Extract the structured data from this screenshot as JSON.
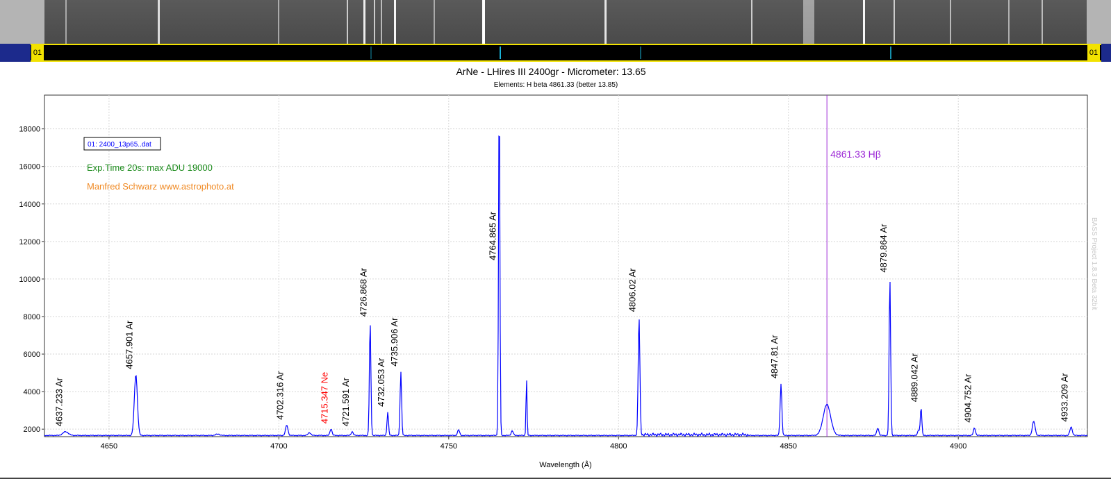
{
  "image_strip": {
    "channel_label_left": "01",
    "channel_label_right": "01"
  },
  "chart_data": {
    "type": "line",
    "title": "ArNe - LHires III 2400gr - Micrometer: 13.65",
    "subtitle": "Elements: H beta 4861.33 (better 13.85)",
    "xlabel": "Wavelength (Å)",
    "ylabel": "",
    "xlim": [
      4631,
      4938
    ],
    "ylim": [
      1600,
      19800
    ],
    "xticks": [
      4650,
      4700,
      4750,
      4800,
      4850,
      4900
    ],
    "yticks": [
      2000,
      4000,
      6000,
      8000,
      10000,
      12000,
      14000,
      16000,
      18000
    ],
    "grid": true,
    "legend": "top-left",
    "baseline": 1650,
    "series": [
      {
        "name": "01: 2400_13p65..dat",
        "color": "#0000ff",
        "peaks": [
          {
            "x": 4637.233,
            "y": 1850,
            "w": 0.8
          },
          {
            "x": 4657.901,
            "y": 4900,
            "w": 0.45
          },
          {
            "x": 4682.0,
            "y": 1720,
            "w": 0.6
          },
          {
            "x": 4702.316,
            "y": 2200,
            "w": 0.35
          },
          {
            "x": 4709.0,
            "y": 1800,
            "w": 0.4
          },
          {
            "x": 4715.347,
            "y": 2000,
            "w": 0.3
          },
          {
            "x": 4721.591,
            "y": 1850,
            "w": 0.3
          },
          {
            "x": 4726.868,
            "y": 7700,
            "w": 0.22
          },
          {
            "x": 4732.053,
            "y": 2900,
            "w": 0.22
          },
          {
            "x": 4735.906,
            "y": 5050,
            "w": 0.22
          },
          {
            "x": 4752.9,
            "y": 1950,
            "w": 0.3
          },
          {
            "x": 4764.865,
            "y": 19800,
            "w": 0.2
          },
          {
            "x": 4768.7,
            "y": 1900,
            "w": 0.3
          },
          {
            "x": 4772.9,
            "y": 4700,
            "w": 0.15
          },
          {
            "x": 4806.02,
            "y": 7950,
            "w": 0.25
          },
          {
            "x": 4847.81,
            "y": 4400,
            "w": 0.25
          },
          {
            "x": 4861.33,
            "y": 3300,
            "w": 1.1
          },
          {
            "x": 4876.3,
            "y": 2050,
            "w": 0.3
          },
          {
            "x": 4879.864,
            "y": 10050,
            "w": 0.22
          },
          {
            "x": 4888.3,
            "y": 1950,
            "w": 0.25
          },
          {
            "x": 4889.042,
            "y": 3150,
            "w": 0.22
          },
          {
            "x": 4904.752,
            "y": 2050,
            "w": 0.3
          },
          {
            "x": 4922.2,
            "y": 2400,
            "w": 0.4
          },
          {
            "x": 4933.209,
            "y": 2100,
            "w": 0.35
          }
        ]
      }
    ],
    "line_labels": [
      {
        "text": "4637.233 Ar",
        "x": 4637.233,
        "color": "#000000"
      },
      {
        "text": "4657.901 Ar",
        "x": 4657.901,
        "color": "#000000"
      },
      {
        "text": "4702.316 Ar",
        "x": 4702.316,
        "color": "#000000"
      },
      {
        "text": "4715.347 Ne",
        "x": 4715.347,
        "color": "#ff0000"
      },
      {
        "text": "4721.591 Ar",
        "x": 4721.591,
        "color": "#000000"
      },
      {
        "text": "4726.868 Ar",
        "x": 4726.868,
        "color": "#000000"
      },
      {
        "text": "4732.053 Ar",
        "x": 4732.053,
        "color": "#000000"
      },
      {
        "text": "4735.906 Ar",
        "x": 4735.906,
        "color": "#000000"
      },
      {
        "text": "4764.865 Ar",
        "x": 4764.865,
        "color": "#000000"
      },
      {
        "text": "4806.02 Ar",
        "x": 4806.02,
        "color": "#000000"
      },
      {
        "text": "4847.81 Ar",
        "x": 4847.81,
        "color": "#000000"
      },
      {
        "text": "4879.864 Ar",
        "x": 4879.864,
        "color": "#000000"
      },
      {
        "text": "4889.042 Ar",
        "x": 4889.042,
        "color": "#000000"
      },
      {
        "text": "4904.752 Ar",
        "x": 4904.752,
        "color": "#000000"
      },
      {
        "text": "4933.209 Ar",
        "x": 4933.209,
        "color": "#000000"
      }
    ],
    "reference_line": {
      "x": 4861.33,
      "label": "4861.33 Hβ",
      "color": "#9c27d6"
    },
    "annotations": [
      {
        "text": "Exp.Time 20s: max ADU 19000",
        "color": "#1a8a1a"
      },
      {
        "text": "Manfred Schwarz www.astrophoto.at",
        "color": "#f08a24"
      }
    ],
    "watermark": "BASS Project 1.8.3 Beta 32bit"
  }
}
